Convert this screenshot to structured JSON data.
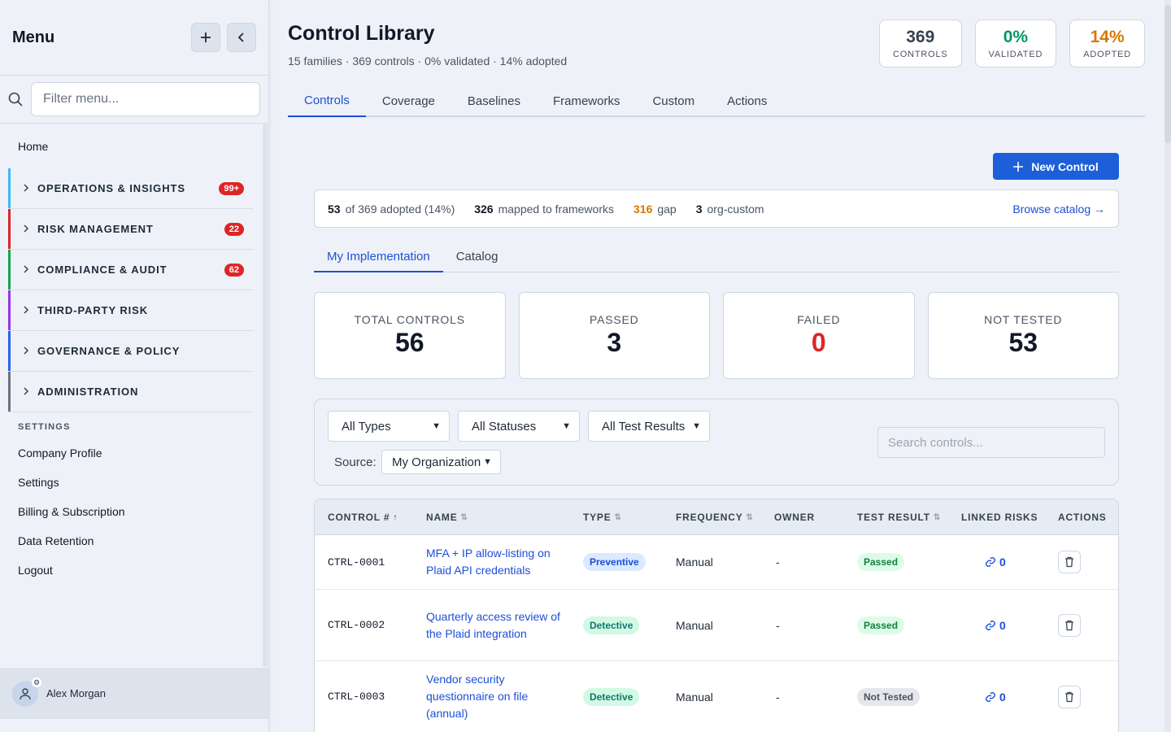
{
  "sidebar": {
    "title": "Menu",
    "add_icon": "plus-icon",
    "collapse_icon": "chevron-left-icon",
    "filter_placeholder": "Filter menu...",
    "home": "Home",
    "groups": [
      {
        "label": "OPERATIONS & INSIGHTS",
        "badge": "99+",
        "color": "#38bdf8"
      },
      {
        "label": "RISK MANAGEMENT",
        "badge": "22",
        "color": "#dc2626"
      },
      {
        "label": "COMPLIANCE & AUDIT",
        "badge": "62",
        "color": "#16a34a"
      },
      {
        "label": "THIRD-PARTY RISK",
        "badge": "",
        "color": "#9333ea"
      },
      {
        "label": "GOVERNANCE & POLICY",
        "badge": "",
        "color": "#2563eb"
      },
      {
        "label": "ADMINISTRATION",
        "badge": "",
        "color": "#6b7280"
      }
    ],
    "settings_header": "SETTINGS",
    "settings_links": [
      "Company Profile",
      "Settings",
      "Billing & Subscription",
      "Data Retention",
      "Logout"
    ],
    "user_name": "Alex Morgan"
  },
  "header": {
    "title": "Control Library",
    "subtitle": "15 families · 369 controls · 0% validated · 14% adopted",
    "kpis": [
      {
        "value": "369",
        "label": "CONTROLS",
        "color": "#374151"
      },
      {
        "value": "0%",
        "label": "VALIDATED",
        "color": "#059669"
      },
      {
        "value": "14%",
        "label": "ADOPTED",
        "color": "#d97706"
      }
    ]
  },
  "tabs": [
    "Controls",
    "Coverage",
    "Baselines",
    "Frameworks",
    "Custom",
    "Actions"
  ],
  "new_control_label": "New Control",
  "summary": {
    "adopted_num": "53",
    "adopted_text": "of 369 adopted (14%)",
    "mapped_num": "326",
    "mapped_text": "mapped to frameworks",
    "gap_num": "316",
    "gap_text": "gap",
    "custom_num": "3",
    "custom_text": "org-custom",
    "browse": "Browse catalog →"
  },
  "subtabs": [
    "My Implementation",
    "Catalog"
  ],
  "stats": [
    {
      "label": "TOTAL CONTROLS",
      "value": "56",
      "color": "#111827"
    },
    {
      "label": "PASSED",
      "value": "3",
      "color": "#111827"
    },
    {
      "label": "FAILED",
      "value": "0",
      "color": "#dc2626"
    },
    {
      "label": "NOT TESTED",
      "value": "53",
      "color": "#111827"
    }
  ],
  "filters": {
    "types": "All Types",
    "statuses": "All Statuses",
    "test_results": "All Test Results",
    "source_label": "Source:",
    "source_value": "My Organization",
    "search_placeholder": "Search controls..."
  },
  "table": {
    "headers": [
      "CONTROL #",
      "NAME",
      "TYPE",
      "FREQUENCY",
      "OWNER",
      "TEST RESULT",
      "LINKED RISKS",
      "ACTIONS"
    ],
    "rows": [
      {
        "id": "CTRL-0001",
        "name": "MFA + IP allow-listing on Plaid API credentials",
        "type": "Preventive",
        "frequency": "Manual",
        "owner": "-",
        "result": "Passed",
        "risks": "0"
      },
      {
        "id": "CTRL-0002",
        "name": "Quarterly access review of the Plaid integration",
        "type": "Detective",
        "frequency": "Manual",
        "owner": "-",
        "result": "Passed",
        "risks": "0"
      },
      {
        "id": "CTRL-0003",
        "name": "Vendor security questionnaire on file (annual)",
        "type": "Detective",
        "frequency": "Manual",
        "owner": "-",
        "result": "Not Tested",
        "risks": "0"
      }
    ]
  }
}
